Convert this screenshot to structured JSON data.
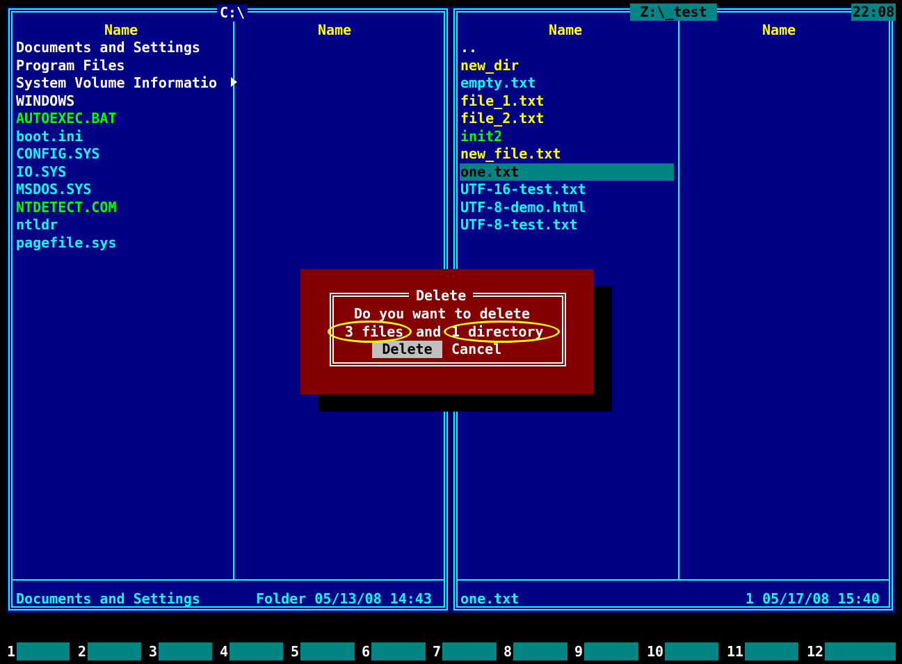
{
  "left_panel": {
    "path": "C:\\",
    "column_headers": [
      "Name",
      "Name"
    ],
    "files": [
      {
        "name": "Documents and Settings",
        "color": "#ffffff"
      },
      {
        "name": "Program Files",
        "color": "#ffffff"
      },
      {
        "name": "System Volume Informatio",
        "color": "#ffffff"
      },
      {
        "name": "WINDOWS",
        "color": "#ffffff"
      },
      {
        "name": "AUTOEXEC.BAT",
        "color": "#00ff00"
      },
      {
        "name": "boot.ini",
        "color": "#00ffff"
      },
      {
        "name": "CONFIG.SYS",
        "color": "#00ffff"
      },
      {
        "name": "IO.SYS",
        "color": "#00ffff"
      },
      {
        "name": "MSDOS.SYS",
        "color": "#00ffff"
      },
      {
        "name": "NTDETECT.COM",
        "color": "#00ff00"
      },
      {
        "name": "ntldr",
        "color": "#00ffff"
      },
      {
        "name": "pagefile.sys",
        "color": "#00ffff"
      }
    ],
    "status_name": "Documents and Settings",
    "status_info": "Folder 05/13/08 14:43"
  },
  "right_panel": {
    "path": "Z:\\_test",
    "clock": "22:08",
    "column_headers": [
      "Name",
      "Name"
    ],
    "files": [
      {
        "name": "..",
        "color": "#ffffff"
      },
      {
        "name": "new_dir",
        "color": "#ffff00"
      },
      {
        "name": "empty.txt",
        "color": "#00ffff"
      },
      {
        "name": "file_1.txt",
        "color": "#ffff00"
      },
      {
        "name": "file_2.txt",
        "color": "#ffff00"
      },
      {
        "name": "init2",
        "color": "#00ff00"
      },
      {
        "name": "new_file.txt",
        "color": "#ffff00"
      },
      {
        "name": "one.txt",
        "color": "#000000"
      },
      {
        "name": "UTF-16-test.txt",
        "color": "#00ffff"
      },
      {
        "name": "UTF-8-demo.html",
        "color": "#00ffff"
      },
      {
        "name": "UTF-8-test.txt",
        "color": "#00ffff"
      }
    ],
    "status_name": "one.txt",
    "status_info": "1 05/17/08 15:40"
  },
  "dialog": {
    "title": "Delete",
    "line1": "Do you want to delete",
    "line2_files": "3 files",
    "line2_and": "and",
    "line2_dir": "1 directory",
    "delete_button": "Delete",
    "cancel_button": "Cancel",
    "background": "#840000",
    "highlight_color": "#ffff00"
  },
  "function_keys": [
    "1",
    "2",
    "3",
    "4",
    "5",
    "6",
    "7",
    "8",
    "9",
    "10",
    "11",
    "12"
  ]
}
